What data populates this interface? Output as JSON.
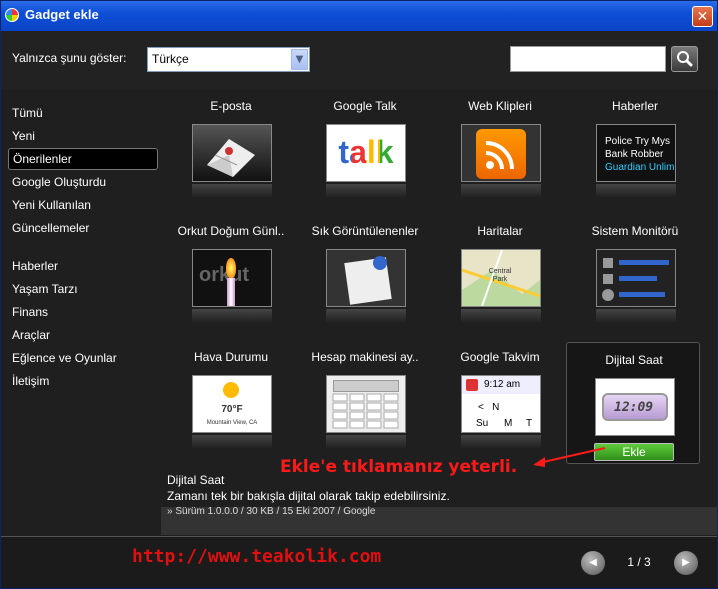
{
  "window": {
    "title": "Gadget ekle",
    "close_label": "✕"
  },
  "filter": {
    "label": "Yalnızca şunu göster:",
    "selected": "Türkçe",
    "search_value": ""
  },
  "sidebar": {
    "items": [
      "Tümü",
      "Yeni",
      "Önerilenler",
      "Google Oluşturdu",
      "Yeni Kullanılan",
      "Güncellemeler",
      "Haberler",
      "Yaşam Tarzı",
      "Finans",
      "Araçlar",
      "Eğlence  ve Oyunlar",
      "İletişim"
    ],
    "selected_index": 2
  },
  "gadgets": [
    {
      "name": "E-posta"
    },
    {
      "name": "Google Talk",
      "thumb_text": "talk"
    },
    {
      "name": "Web Klipleri"
    },
    {
      "name": "Haberler",
      "thumb_lines": [
        "Police Try Mys",
        "Bank Robber",
        "Guardian Unlim"
      ]
    },
    {
      "name": "Orkut Doğum Günl..",
      "thumb_text": "orkut"
    },
    {
      "name": "Sık Görüntülenenler"
    },
    {
      "name": "Haritalar",
      "thumb_text": "Central Park"
    },
    {
      "name": "Sistem Monitörü"
    },
    {
      "name": "Hava Durumu",
      "thumb_text": "70°F",
      "thumb_sub": "Mountain View, CA"
    },
    {
      "name": "Hesap makinesi ay.."
    },
    {
      "name": "Google Takvim",
      "thumb_time": "9:12 am",
      "thumb_nav": "<   N",
      "thumb_days": [
        "Su",
        "M",
        "T"
      ]
    },
    {
      "name": "Dijital Saat",
      "thumb_text": "12:09"
    }
  ],
  "add_button": "Ekle",
  "annotation": "Ekle'e tıklamanız yeterli.",
  "info": {
    "name": "Dijital Saat",
    "description": "Zamanı tek bir bakışla dijital olarak takip edebilirsiniz.",
    "meta": "» Sürüm 1.0.0.0 / 30 KB / 15 Eki 2007 / Google"
  },
  "footer": {
    "url": "http://www.teakolik.com",
    "page": "1 / 3",
    "prev": "◀",
    "next": "▶"
  }
}
